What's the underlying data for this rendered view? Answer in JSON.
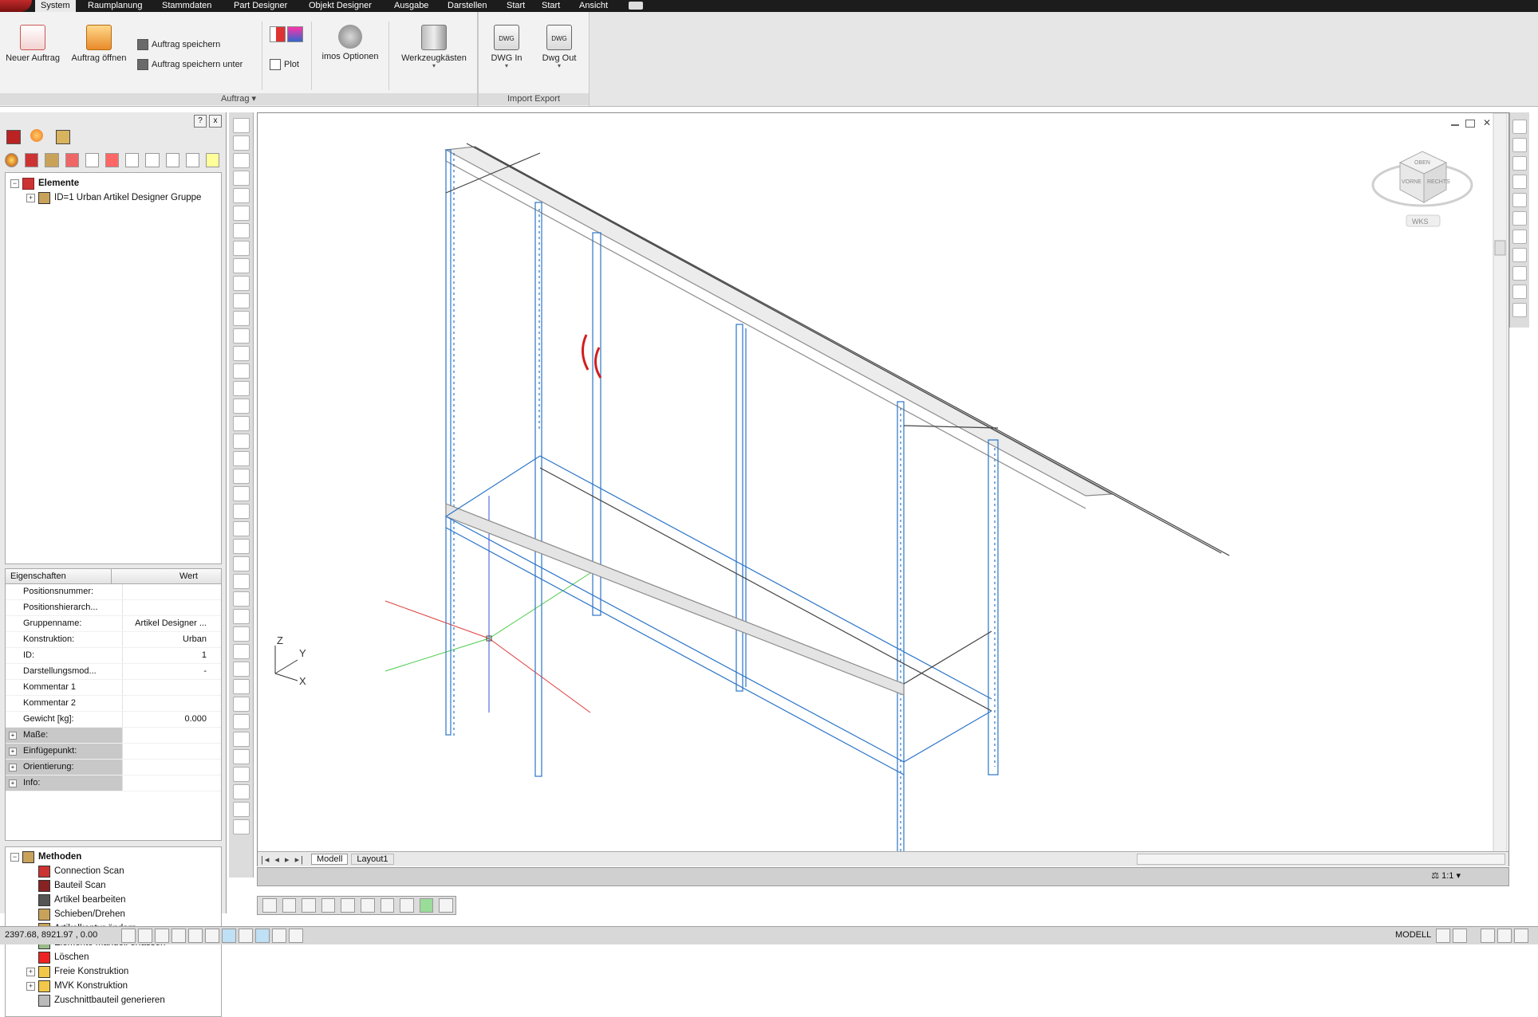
{
  "menu": {
    "tabs": [
      "System",
      "Raumplanung",
      "Stammdaten",
      "Part Designer",
      "Objekt Designer",
      "Ausgabe",
      "Darstellen",
      "Start",
      "Start",
      "Ansicht"
    ]
  },
  "ribbon": {
    "new_order": "Neuer Auftrag",
    "open_order": "Auftrag öffnen",
    "save_order": "Auftrag speichern",
    "save_order_as": "Auftrag speichern unter",
    "plot": "Plot",
    "imos_options": "imos Optionen",
    "toolboxes": "Werkzeugkästen",
    "dwg_in": "DWG In",
    "dwg_out": "Dwg Out",
    "group_order": "Auftrag",
    "group_import_export": "Import Export"
  },
  "left_panel": {
    "help_glyph": "?",
    "close_glyph": "x",
    "tree": {
      "root": "Elemente",
      "child": "ID=1 Urban Artikel Designer Gruppe"
    },
    "properties": {
      "col_name": "Eigenschaften",
      "col_value": "Wert",
      "rows": [
        {
          "name": "Positionsnummer:",
          "value": ""
        },
        {
          "name": "Positionshierarch...",
          "value": ""
        },
        {
          "name": "Gruppenname:",
          "value": "Artikel Designer ..."
        },
        {
          "name": "Konstruktion:",
          "value": "Urban"
        },
        {
          "name": "ID:",
          "value": "1"
        },
        {
          "name": "Darstellungsmod...",
          "value": "-"
        },
        {
          "name": "Kommentar 1",
          "value": ""
        },
        {
          "name": "Kommentar 2",
          "value": ""
        },
        {
          "name": "Gewicht [kg]:",
          "value": "0.000"
        }
      ],
      "groups": [
        "Maße:",
        "Einfügepunkt:",
        "Orientierung:",
        "Info:"
      ]
    },
    "methods": {
      "root": "Methoden",
      "items": [
        "Connection Scan",
        "Bauteil Scan",
        "Artikel bearbeiten",
        "Schieben/Drehen",
        "Artikelkontur ändern",
        "Elemente manuell erfassen",
        "Löschen",
        "Freie Konstruktion",
        "MVK Konstruktion",
        "Zuschnittbauteil generieren"
      ]
    }
  },
  "viewport": {
    "viewcube_top": "OBEN",
    "viewcube_front": "VORNE",
    "viewcube_right": "RECHTS",
    "wcs_label": "WKS",
    "ucs_x": "X",
    "ucs_y": "Y",
    "ucs_z": "Z",
    "tabs": [
      "Modell",
      "Layout1"
    ],
    "scale_label": "1:1"
  },
  "status": {
    "coordinates": "2397.68, 8921.97 , 0.00",
    "model_label": "MODELL"
  },
  "colors": {
    "menubar": "#1c1c1c",
    "ribbon": "#f2f2f2",
    "drawing_blue": "#2a74c8",
    "drawing_gray": "#8c8c8c",
    "handle_red": "#d21f1f",
    "axis_red": "#e04040",
    "axis_green": "#4ccc4c",
    "axis_blue": "#3a50e0"
  }
}
